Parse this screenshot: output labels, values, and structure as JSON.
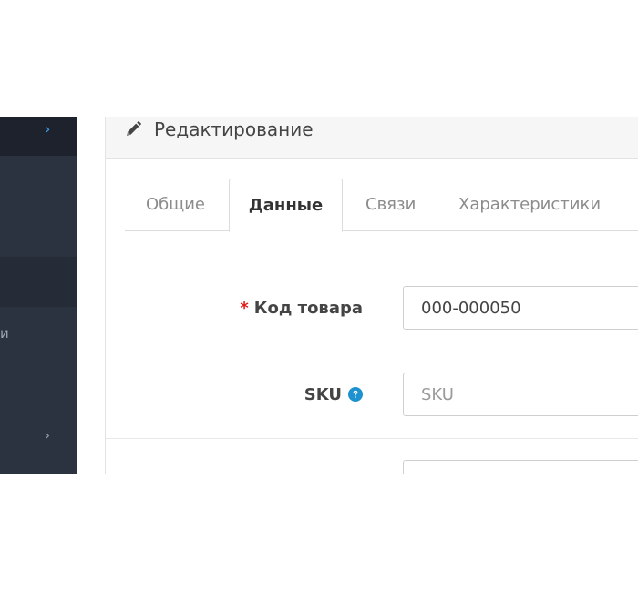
{
  "sidebar": {
    "top_chevron": "›",
    "item_fragment": "и",
    "lower_chevron": "›"
  },
  "panel": {
    "title": "Редактирование",
    "icon": "pencil-icon"
  },
  "tabs": [
    {
      "label": "Общие"
    },
    {
      "label": "Данные",
      "active": true
    },
    {
      "label": "Связи"
    },
    {
      "label": "Характеристики"
    }
  ],
  "form": {
    "product_code": {
      "required_mark": "*",
      "label": "Код товара",
      "value": "000-000050"
    },
    "sku": {
      "label": "SKU",
      "placeholder": "SKU",
      "value": "",
      "help_icon": "question-circle-icon"
    }
  },
  "colors": {
    "accent": "#3aa0f0",
    "help": "#1e91cf",
    "required": "#e01b1b",
    "sidebar_bg": "#2b3240"
  }
}
